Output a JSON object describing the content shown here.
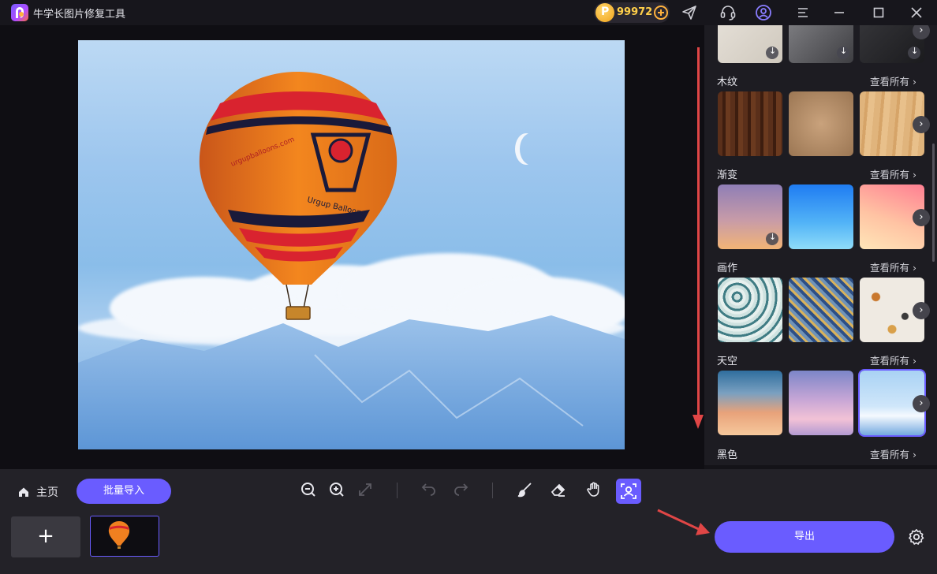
{
  "app": {
    "title": "牛学长图片修复工具",
    "coins": "99972"
  },
  "titlebar_icons": [
    "send-icon",
    "support-headset-icon",
    "user-icon",
    "menu-icon",
    "minimize-icon",
    "maximize-icon",
    "close-icon"
  ],
  "canvas": {
    "balloon_text": "urgupballoons.com",
    "balloon_brand": "Urgup Balloons"
  },
  "panel": {
    "see_all": "查看所有",
    "categories": [
      {
        "title": "木纹",
        "thumbs": [
          "wood-dark",
          "wood-light",
          "wood-pine"
        ]
      },
      {
        "title": "渐变",
        "thumbs": [
          "gradient-purple-orange",
          "gradient-blue",
          "gradient-pink-cream"
        ]
      },
      {
        "title": "画作",
        "thumbs": [
          "pattern-teal",
          "pattern-blue-gold",
          "pattern-floral"
        ]
      },
      {
        "title": "天空",
        "thumbs": [
          "sky-sunset-clouds",
          "sky-pink-clouds",
          "sky-blue-clouds"
        ]
      },
      {
        "title": "黑色",
        "thumbs": []
      }
    ]
  },
  "bottom": {
    "home_label": "主页",
    "batch_import": "批量导入",
    "add_symbol": "+",
    "export": "导出"
  },
  "colors": {
    "accent": "#6a5cff",
    "annotation_red": "#e04646",
    "coin_gold": "#ffcf4a"
  }
}
